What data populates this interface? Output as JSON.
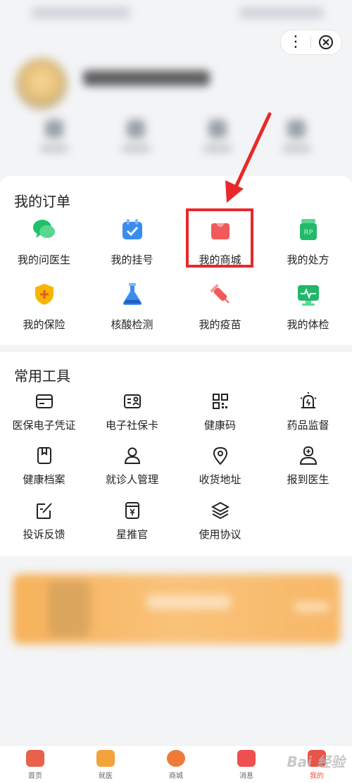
{
  "orders": {
    "title": "我的订单",
    "items": [
      {
        "label": "我的问医生",
        "icon": "chat-bubble-icon",
        "color": "#1fc16b"
      },
      {
        "label": "我的挂号",
        "icon": "calendar-check-icon",
        "color": "#3a8cf0"
      },
      {
        "label": "我的商城",
        "icon": "shopping-bag-icon",
        "color": "#f05a5a"
      },
      {
        "label": "我的处方",
        "icon": "prescription-bottle-icon",
        "color": "#23b96a"
      },
      {
        "label": "我的保险",
        "icon": "shield-plus-icon",
        "color": "#f7b500"
      },
      {
        "label": "核酸检测",
        "icon": "flask-icon",
        "color": "#3a8cf0"
      },
      {
        "label": "我的疫苗",
        "icon": "syringe-icon",
        "color": "#f05a5a"
      },
      {
        "label": "我的体检",
        "icon": "monitor-heartbeat-icon",
        "color": "#1fb86a"
      }
    ]
  },
  "tools": {
    "title": "常用工具",
    "items": [
      {
        "label": "医保电子凭证",
        "icon": "card-icon"
      },
      {
        "label": "电子社保卡",
        "icon": "id-card-icon"
      },
      {
        "label": "健康码",
        "icon": "qr-code-icon"
      },
      {
        "label": "药品监督",
        "icon": "alarm-light-icon"
      },
      {
        "label": "健康档案",
        "icon": "file-bookmark-icon"
      },
      {
        "label": "就诊人管理",
        "icon": "person-icon"
      },
      {
        "label": "收货地址",
        "icon": "location-pin-icon"
      },
      {
        "label": "报到医生",
        "icon": "doctor-icon"
      },
      {
        "label": "投诉反馈",
        "icon": "edit-note-icon"
      },
      {
        "label": "星推官",
        "icon": "yen-tag-icon"
      },
      {
        "label": "使用协议",
        "icon": "layers-icon"
      }
    ]
  },
  "tabbar": {
    "items": [
      {
        "label": "首页",
        "icon": "shop-icon",
        "color": "#e8614a"
      },
      {
        "label": "就医",
        "icon": "medical-kit-icon",
        "color": "#f3a33a"
      },
      {
        "label": "商城",
        "icon": "mall-coin-icon",
        "color": "#f07a3a"
      },
      {
        "label": "消息",
        "icon": "heart-message-icon",
        "color": "#ef4f4f"
      },
      {
        "label": "我的",
        "icon": "profile-icon",
        "color": "#e8544a"
      }
    ]
  },
  "watermark": "Bai 经验",
  "colors": {
    "highlight": "#e8292b",
    "arrow": "#e8292b"
  }
}
